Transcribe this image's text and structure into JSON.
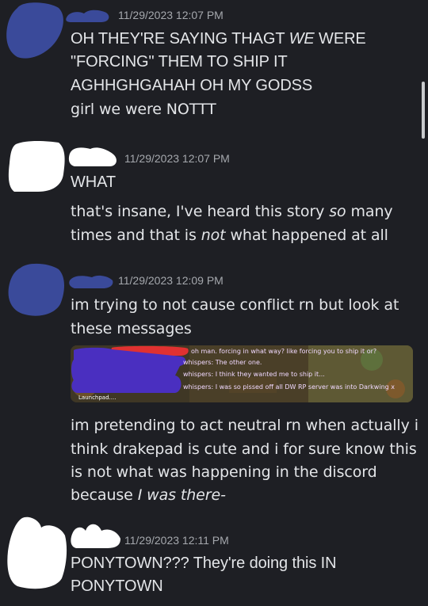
{
  "messages": [
    {
      "timestamp": "11/29/2023 12:07 PM",
      "lines": [
        "OH THEY'RE SAYING THAGT ",
        "WE",
        " WERE",
        "\"FORCING\" THEM TO SHIP IT",
        "AGHHGHGAHAH OH MY GODSS",
        "girl we were NOTTT"
      ]
    },
    {
      "timestamp": "11/29/2023 12:07 PM",
      "lines": [
        "WHAT",
        "that's insane, I've heard this story ",
        "so",
        " many",
        "times and that is ",
        "not",
        " what happened at all"
      ]
    },
    {
      "timestamp": "11/29/2023 12:09 PM",
      "lines": [
        "im trying to not cause conflict rn but look at",
        "these messages"
      ],
      "embed": {
        "chat_lines": [
          "oh man. forcing in what way? like forcing you to ship it or?",
          "whispers: The other one.",
          "whispers: I think they wanted me to ship it...",
          "whispers: I was so pissed off all DW RP server was into Darkwing x"
        ],
        "footer": "Launchpad...."
      },
      "after_lines": [
        "im pretending to act neutral rn when actually i",
        "think drakepad is cute and i for sure know this",
        "is not what was happening in the discord",
        "because ",
        "I was there-"
      ]
    },
    {
      "timestamp": "11/29/2023 12:11 PM",
      "lines": [
        "PONYTOWN??? They're doing this IN",
        "PONYTOWN"
      ]
    }
  ]
}
